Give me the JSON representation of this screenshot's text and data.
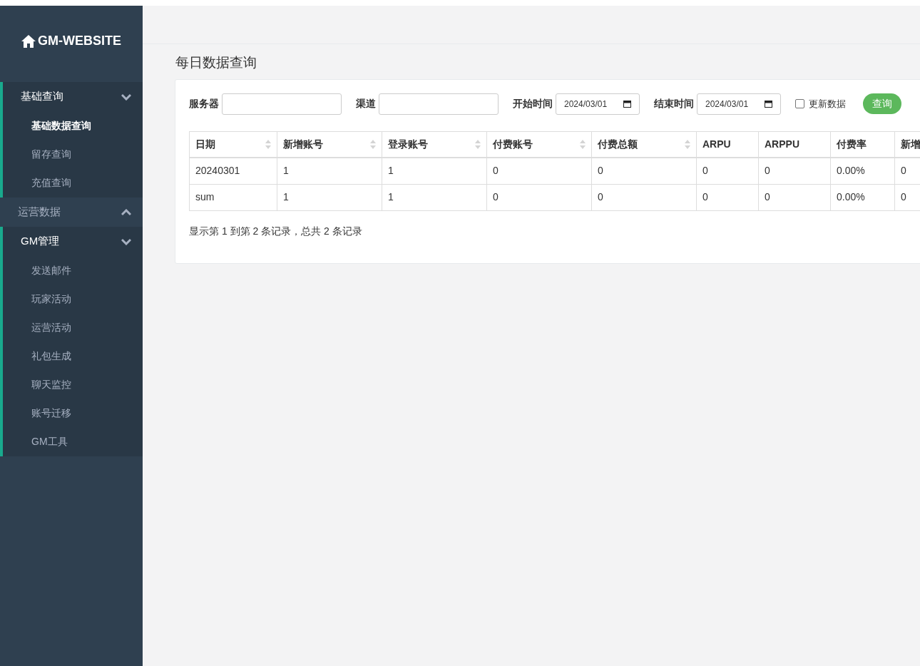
{
  "brand": {
    "title": "GM-WEBSITE"
  },
  "sidebar": {
    "groups": [
      {
        "label": "基础查询",
        "expanded": true,
        "items": [
          {
            "label": "基础数据查询",
            "selected": true
          },
          {
            "label": "留存查询",
            "selected": false
          },
          {
            "label": "充值查询",
            "selected": false
          }
        ]
      },
      {
        "label": "运营数据",
        "expanded": false
      },
      {
        "label": "GM管理",
        "expanded": true,
        "items": [
          {
            "label": "发送邮件",
            "selected": false
          },
          {
            "label": "玩家活动",
            "selected": false
          },
          {
            "label": "运营活动",
            "selected": false
          },
          {
            "label": "礼包生成",
            "selected": false
          },
          {
            "label": "聊天监控",
            "selected": false
          },
          {
            "label": "账号迁移",
            "selected": false
          },
          {
            "label": "GM工具",
            "selected": false
          }
        ]
      }
    ]
  },
  "page_title": "每日数据查询",
  "filters": {
    "fields": [
      {
        "kind": "text",
        "label": "服务器"
      },
      {
        "kind": "text",
        "label": "渠道"
      },
      {
        "kind": "date",
        "label": "开始时间",
        "value": "2024/03/01"
      },
      {
        "kind": "date",
        "label": "结束时间",
        "value": "2024/03/01"
      }
    ],
    "checkbox": {
      "label": "更新数据",
      "checked": false
    },
    "button": "查询"
  },
  "table": {
    "columns": [
      {
        "label": "日期",
        "sortable": true
      },
      {
        "label": "新增账号",
        "sortable": true
      },
      {
        "label": "登录账号",
        "sortable": true
      },
      {
        "label": "付费账号",
        "sortable": true
      },
      {
        "label": "付费总额",
        "sortable": true
      },
      {
        "label": "ARPU",
        "sortable": false
      },
      {
        "label": "ARPPU",
        "sortable": false
      },
      {
        "label": "付费率",
        "sortable": false
      },
      {
        "label": "新增"
      }
    ],
    "rows": [
      [
        "20240301",
        "1",
        "1",
        "0",
        "0",
        "0",
        "0",
        "0.00%",
        "0"
      ],
      [
        "sum",
        "1",
        "1",
        "0",
        "0",
        "0",
        "0",
        "0.00%",
        "0"
      ]
    ]
  },
  "pagination_info": "显示第 1 到第 2 条记录，总共 2 条记录"
}
